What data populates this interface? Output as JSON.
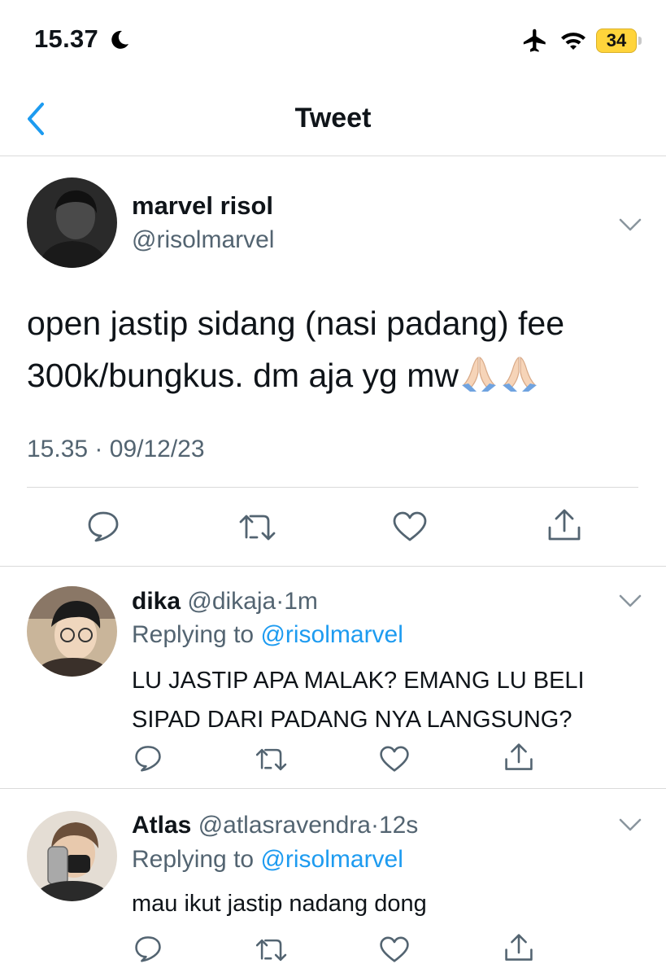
{
  "status_bar": {
    "time": "15.37",
    "battery_level": "34",
    "icons": [
      "moon-icon",
      "airplane-icon",
      "wifi-icon",
      "battery-icon"
    ],
    "battery_color": "#ffd43b"
  },
  "nav": {
    "title": "Tweet",
    "back_icon": "chevron-left-icon",
    "accent": "#1d9bf0"
  },
  "tweet": {
    "name": "marvel risol",
    "handle": "@risolmarvel",
    "text": "open jastip sidang (nasi padang) fee 300k/bungkus. dm aja yg mw",
    "emoji": [
      "folded-hands-icon",
      "folded-hands-icon"
    ],
    "time": "15.35",
    "dot": "·",
    "date": "09/12/23",
    "actions": [
      "reply-icon",
      "retweet-icon",
      "like-icon",
      "share-icon"
    ]
  },
  "replies": [
    {
      "name": "dika",
      "handle": "@dikaja",
      "dot": "·",
      "age": "1m",
      "replying_prefix": "Replying to",
      "replying_to": "@risolmarvel",
      "text": "LU JASTIP APA MALAK? EMANG LU BELI SIPAD DARI PADANG NYA LANGSUNG?"
    },
    {
      "name": "Atlas",
      "handle": "@atlasravendra",
      "dot": "·",
      "age": "12s",
      "replying_prefix": "Replying to",
      "replying_to": "@risolmarvel",
      "text": "mau ikut jastip nadang dong"
    }
  ]
}
